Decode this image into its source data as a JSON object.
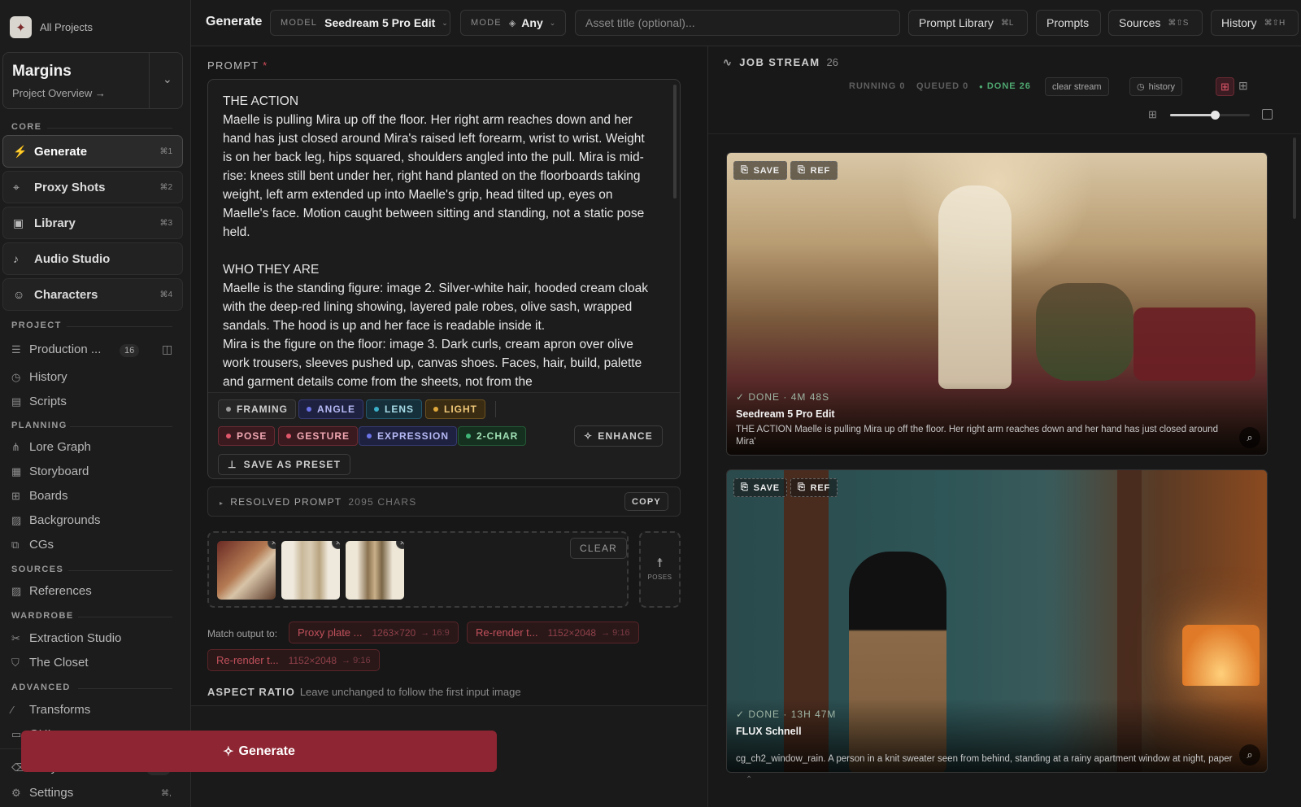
{
  "sidebar": {
    "all_projects": "All Projects",
    "project_name": "Margins",
    "project_sub": "Project Overview →",
    "core_label": "CORE",
    "core_items": [
      {
        "label": "Generate",
        "kbd": "⌘1",
        "icon": "bolt-icon"
      },
      {
        "label": "Proxy Shots",
        "kbd": "⌘2",
        "icon": "pin-icon"
      },
      {
        "label": "Library",
        "kbd": "⌘3",
        "icon": "library-icon"
      },
      {
        "label": "Audio Studio",
        "kbd": "",
        "icon": "music-note-icon"
      },
      {
        "label": "Characters",
        "kbd": "⌘4",
        "icon": "people-icon"
      }
    ],
    "project_label": "PROJECT",
    "production_label": "Production ...",
    "production_count": "16",
    "history": "History",
    "scripts": "Scripts",
    "planning_label": "PLANNING",
    "planning_items": [
      "Lore Graph",
      "Storyboard",
      "Boards",
      "Backgrounds",
      "CGs"
    ],
    "sources_label": "SOURCES",
    "references": "References",
    "wardrobe_label": "WARDROBE",
    "wardrobe_items": [
      "Extraction Studio",
      "The Closet"
    ],
    "advanced_label": "ADVANCED",
    "advanced_items": [
      "Transforms",
      "GUI"
    ],
    "recycle_bin": "Recycle Bin",
    "recycle_count": "103",
    "settings": "Settings",
    "settings_kbd": "⌘,"
  },
  "topbar": {
    "title": "Generate",
    "model_key": "MODEL",
    "model_value": "Seedream 5 Pro Edit",
    "mode_key": "MODE",
    "mode_value": "Any",
    "asset_placeholder": "Asset title (optional)...",
    "prompt_library": "Prompt Library",
    "prompt_library_kbd": "⌘L",
    "prompts": "Prompts",
    "sources": "Sources",
    "sources_kbd": "⌘⇧S",
    "history": "History",
    "history_kbd": "⌘⇧H"
  },
  "prompt": {
    "label": "PROMPT",
    "required_mark": "*",
    "text": "THE ACTION\nMaelle is pulling Mira up off the floor. Her right arm reaches down and her hand has just closed around Mira's raised left forearm, wrist to wrist. Weight is on her back leg, hips squared, shoulders angled into the pull. Mira is mid-rise: knees still bent under her, right hand planted on the floorboards taking weight, left arm extended up into Maelle's grip, head tilted up, eyes on Maelle's face. Motion caught between sitting and standing, not a static pose held.\n\nWHO THEY ARE\nMaelle is the standing figure: image 2. Silver-white hair, hooded cream cloak with the deep-red lining showing, layered pale robes, olive sash, wrapped sandals. The hood is up and her face is readable inside it.\nMira is the figure on the floor: image 3. Dark curls, cream apron over olive work trousers, sleeves pushed up, canvas shoes. Faces, hair, build, palette and garment details come from the sheets, not from the",
    "tags_row1": [
      {
        "label": "FRAMING",
        "color": "#9a9a9a"
      },
      {
        "label": "ANGLE",
        "color": "#6b73e8"
      },
      {
        "label": "LENS",
        "color": "#3bb0c9"
      },
      {
        "label": "LIGHT",
        "color": "#e0a83c"
      }
    ],
    "tags_row2": [
      {
        "label": "POSE",
        "color": "#e0566a"
      },
      {
        "label": "GESTURE",
        "color": "#e0566a"
      },
      {
        "label": "EXPRESSION",
        "color": "#6b73e8"
      },
      {
        "label": "2-CHAR",
        "color": "#3fb678"
      }
    ],
    "enhance": "ENHANCE",
    "save_preset": "SAVE AS PRESET"
  },
  "resolved": {
    "label": "RESOLVED PROMPT",
    "chars": "2095 CHARS",
    "copy": "COPY"
  },
  "refs": {
    "clear": "CLEAR",
    "poses": "POSES"
  },
  "match": {
    "label": "Match output to:",
    "chips": [
      {
        "name": "Proxy plate ...",
        "dims": "1263×720",
        "ratio": "→ 16:9"
      },
      {
        "name": "Re-render t...",
        "dims": "1152×2048",
        "ratio": "→ 9:16"
      },
      {
        "name": "Re-render t...",
        "dims": "1152×2048",
        "ratio": "→ 9:16"
      }
    ]
  },
  "aspect": {
    "label": "ASPECT RATIO",
    "hint": "Leave unchanged to follow the first input image"
  },
  "generate_button": "Generate",
  "job_stream": {
    "title": "JOB STREAM",
    "count": "26",
    "running": "RUNNING 0",
    "queued": "QUEUED 0",
    "done": "DONE 26",
    "clear_stream": "clear stream",
    "history": "history",
    "cards": [
      {
        "save": "SAVE",
        "ref": "REF",
        "status": "✓ DONE · 4M 48S",
        "model": "Seedream 5 Pro Edit",
        "desc": "THE ACTION Maelle is pulling Mira up off the floor. Her right arm reaches down and her hand has just closed around Mira'"
      },
      {
        "save": "SAVE",
        "ref": "REF",
        "status": "✓ DONE · 13H 47M",
        "model": "FLUX Schnell",
        "desc": "cg_ch2_window_rain. A person in a knit sweater seen from behind, standing at a rainy apartment window at night, paper"
      }
    ]
  },
  "colors": {
    "accent": "#8e2532",
    "done_green": "#4fa871",
    "background": "#171717"
  }
}
